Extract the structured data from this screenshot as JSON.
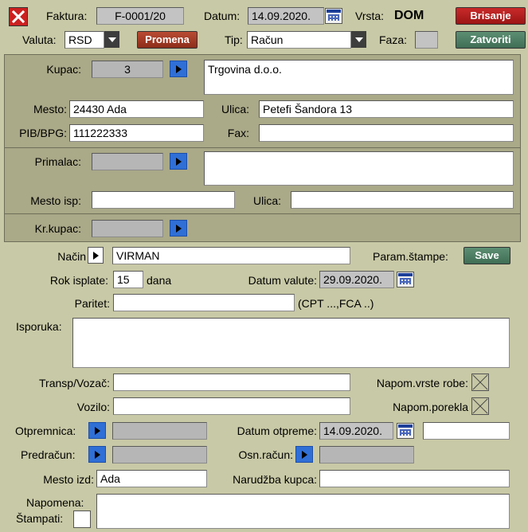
{
  "header": {
    "faktura_label": "Faktura:",
    "faktura_value": "F-0001/20",
    "datum_label": "Datum:",
    "datum_value": "14.09.2020.",
    "vrsta_label": "Vrsta:",
    "vrsta_value": "DOM",
    "brisanje": "Brisanje",
    "zatvoriti": "Zatvoriti",
    "valuta_label": "Valuta:",
    "valuta_value": "RSD",
    "promena": "Promena",
    "tip_label": "Tip:",
    "tip_value": "Račun",
    "faza_label": "Faza:",
    "faza_value": ""
  },
  "kupac": {
    "label": "Kupac:",
    "code": "3",
    "name": "Trgovina d.o.o.",
    "mesto_label": "Mesto:",
    "mesto_value": "24430 Ada",
    "ulica_label": "Ulica:",
    "ulica_value": "Petefi Šandora 13",
    "pib_label": "PIB/BPG:",
    "pib_value": "111222333",
    "fax_label": "Fax:",
    "fax_value": ""
  },
  "primalac": {
    "label": "Primalac:",
    "code": "",
    "name": "",
    "mesto_label": "Mesto isp:",
    "mesto_value": "",
    "ulica_label": "Ulica:",
    "ulica_value": ""
  },
  "krkupac": {
    "label": "Kr.kupac:",
    "code": ""
  },
  "details": {
    "nacin_label": "Način",
    "nacin_value": "VIRMAN",
    "param_label": "Param.štampe:",
    "save": "Save",
    "rok_label": "Rok isplate:",
    "rok_value": "15",
    "dana": "dana",
    "datum_valute_label": "Datum valute:",
    "datum_valute_value": "29.09.2020.",
    "paritet_label": "Paritet:",
    "paritet_value": "",
    "paritet_hint": "(CPT ...,FCA ..)",
    "isporuka_label": "Isporuka:",
    "isporuka_value": "",
    "transp_label": "Transp/Vozač:",
    "transp_value": "",
    "napom_vrste_label": "Napom.vrste robe:",
    "vozilo_label": "Vozilo:",
    "vozilo_value": "",
    "napom_porekla_label": "Napom.porekla",
    "otpremnica_label": "Otpremnica:",
    "otpremnica_value": "",
    "datum_otpreme_label": "Datum otpreme:",
    "datum_otpreme_value": "14.09.2020.",
    "datum_otpreme_extra": "",
    "predracun_label": "Predračun:",
    "predracun_value": "",
    "osn_racun_label": "Osn.račun:",
    "osn_racun_value": "",
    "mesto_izd_label": "Mesto izd:",
    "mesto_izd_value": "Ada",
    "narudzba_label": "Narudžba kupca:",
    "narudzba_value": "",
    "napomena_label": "Napomena:",
    "napomena_value": "",
    "stampati_label": "Štampati:"
  },
  "colors": {
    "background": "#c8c9a6",
    "panel": "#aaa988",
    "arrow_button": "#2f6fd6",
    "delete_button": "#b81f1f",
    "close_button": "#4d7d63"
  }
}
